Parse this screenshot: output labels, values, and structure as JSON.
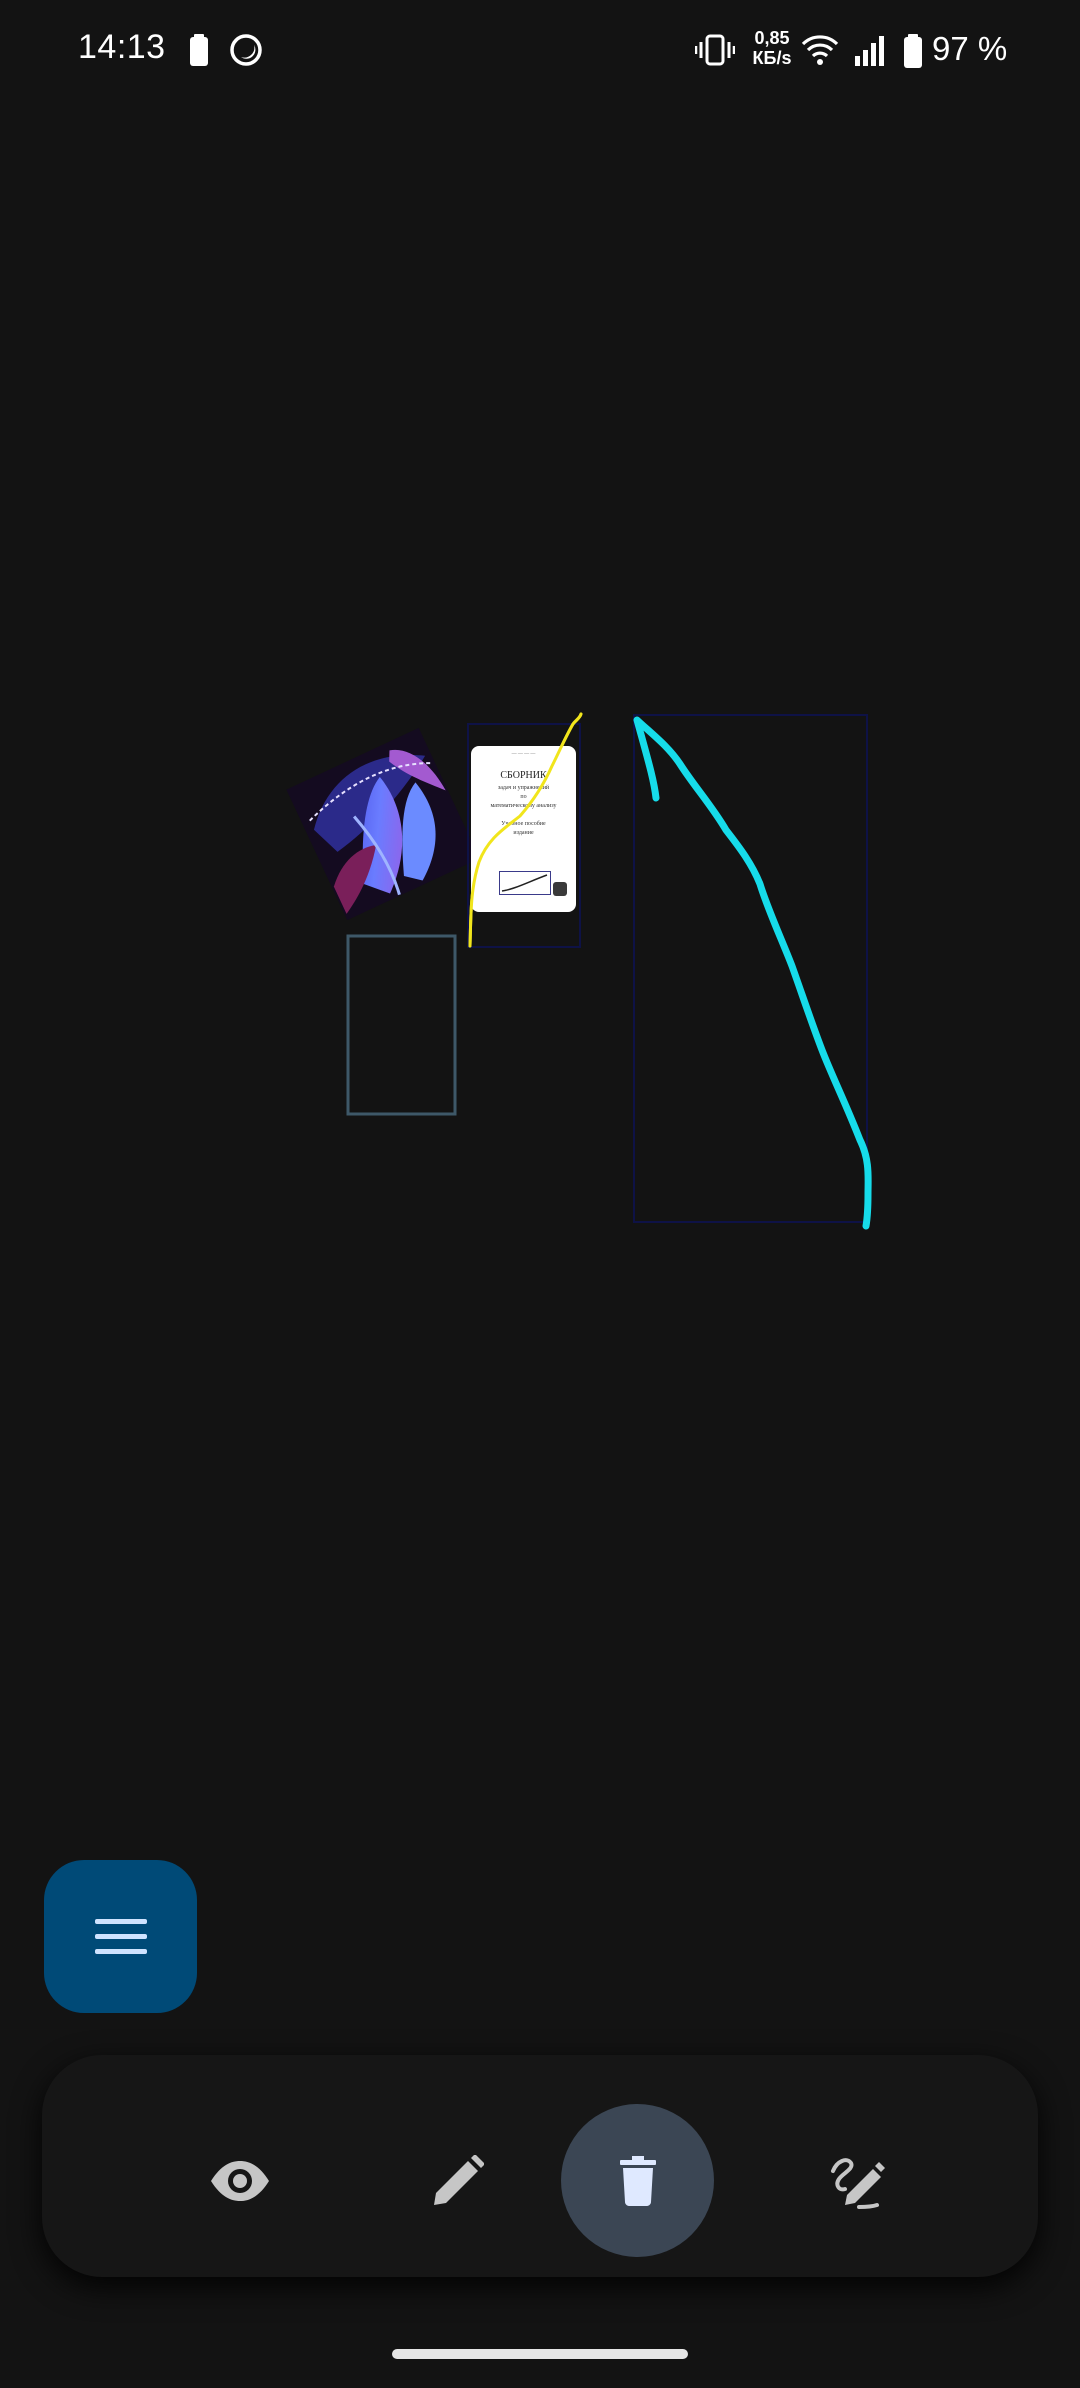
{
  "status_bar": {
    "time": "14:13",
    "net_speed_value": "0,85",
    "net_speed_unit": "КБ/s",
    "battery_percent": "97 %",
    "icons": [
      "battery-saver-icon",
      "moon-icon",
      "vibrate-icon",
      "wifi-icon",
      "cellular-signal-icon",
      "battery-icon"
    ]
  },
  "canvas": {
    "document_preview": {
      "header": "— — — —",
      "title": "СБОРНИК",
      "subtitle_lines": [
        "задач и упражнений",
        "по",
        "математическому анализу",
        "",
        "Учебное пособие",
        "издание"
      ]
    },
    "stroke_colors": {
      "cyan": "#16dcea",
      "yellow": "#f1e51c",
      "empty_frame": "#3e5868",
      "selection_frame": "#0e1246"
    }
  },
  "fab": {
    "icon": "menu-icon",
    "color": "#004a77"
  },
  "toolbar": {
    "tools": [
      {
        "name": "view",
        "icon": "eye-icon",
        "active": false
      },
      {
        "name": "draw",
        "icon": "pencil-icon",
        "active": false
      },
      {
        "name": "delete",
        "icon": "trash-icon",
        "active": true
      },
      {
        "name": "handwriting",
        "icon": "handwriting-pencil-icon",
        "active": false
      }
    ],
    "active_color": "#3b4654"
  }
}
